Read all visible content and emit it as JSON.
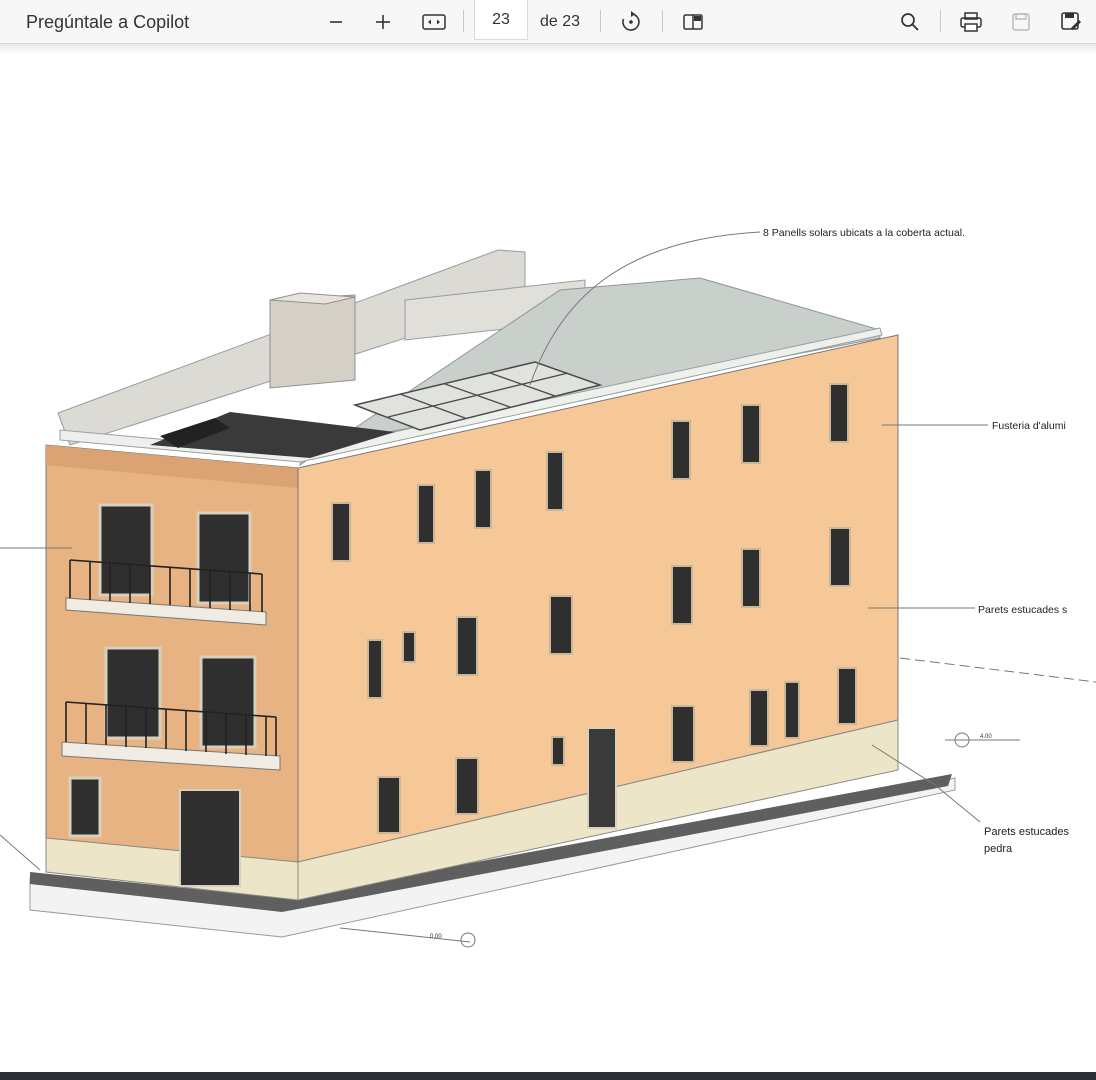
{
  "toolbar": {
    "copilot_label": "Pregúntale a Copilot",
    "page_current": "23",
    "page_total": "de 23",
    "icons": {
      "zoom_out": "minus-icon",
      "zoom_in": "plus-icon",
      "fit": "fit-page-icon",
      "rotate": "rotate-icon",
      "page_view": "page-view-icon",
      "search": "search-icon",
      "print": "print-icon",
      "save": "save-icon",
      "save_as": "save-as-icon"
    }
  },
  "drawing": {
    "annotations": {
      "solar": "8 Panells solars ubicats a la coberta actual.",
      "fusteria": "Fusteria d'alumi",
      "parets1": "Parets estucades s",
      "parets2_line1": "Parets estucades",
      "parets2_line2": "pedra",
      "level_right": "4.00",
      "level_bottom": "0.00"
    }
  },
  "colors": {
    "facade": "#f6c898",
    "facade_shadow": "#e8b382",
    "plinth": "#ede5c8",
    "roof": "#c9d0cc",
    "toolbar_bg": "#f7f7f7"
  }
}
